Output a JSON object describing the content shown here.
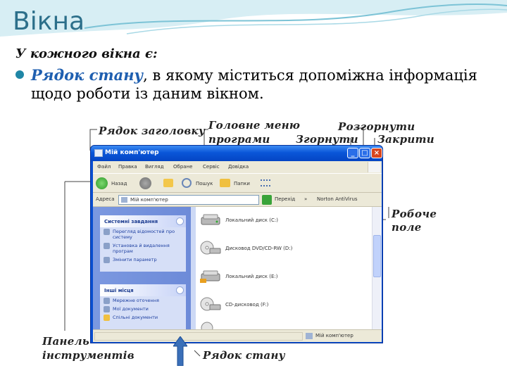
{
  "slide": {
    "title": "Вікна",
    "subtitle": "У кожного вікна є:",
    "bullet_term": "Рядок стану",
    "bullet_rest": ", в якому міститься допоміжна інформація щодо роботи із даним вікном."
  },
  "annotations": {
    "title_bar": "Рядок заголовку",
    "main_menu_1": "Головне меню",
    "main_menu_2": "програми",
    "maximize": "Розгорнути",
    "minimize": "Згорнути",
    "close": "Закрити",
    "work_area_1": "Робоче",
    "work_area_2": "поле",
    "toolbar_1": "Панель",
    "toolbar_2": "інструментів",
    "status_bar": "Рядок стану"
  },
  "window": {
    "title": "Мій комп'ютер",
    "menu": [
      "Файл",
      "Правка",
      "Вигляд",
      "Обране",
      "Сервіс",
      "Довідка"
    ],
    "toolbar": {
      "back": "Назад",
      "search": "Пошук",
      "folders": "Папки"
    },
    "address": {
      "label": "Адреса",
      "value": "Мій комп'ютер",
      "go": "Перехід",
      "links": "Norton AntiVirus"
    },
    "tasks_panel": {
      "header": "Системні завдання",
      "items": [
        "Перегляд відомостей про систему",
        "Установка й видалення програм",
        "Змінити параметр"
      ]
    },
    "places_panel": {
      "header": "Інші місця",
      "items": [
        "Мережне оточення",
        "Мої документи",
        "Спільні документи"
      ]
    },
    "drives": [
      "Локальний диск (C:)",
      "Дисковод DVD/CD-RW (D:)",
      "Локальний диск (E:)",
      "CD-дисковод (F:)"
    ],
    "status_text": "Мій комп'ютер"
  },
  "colors": {
    "title": "#2c6f8a",
    "accent": "#1f86a6",
    "titlebar": "#0a56d8",
    "close": "#d8461f"
  }
}
